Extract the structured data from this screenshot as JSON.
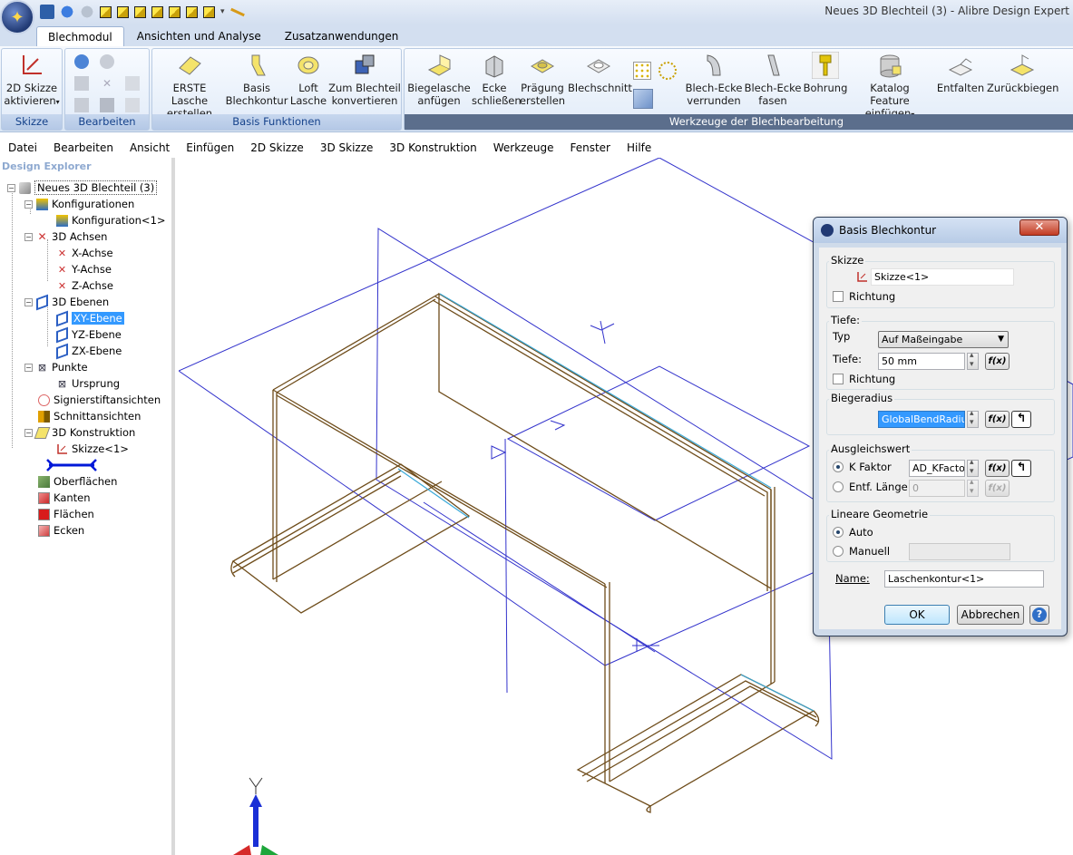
{
  "window": {
    "title": "Neues 3D Blechteil (3) - Alibre Design Expert"
  },
  "ribbon_tabs": [
    "Blechmodul",
    "Ansichten und Analyse",
    "Zusatzanwendungen"
  ],
  "ribbon": {
    "groups": {
      "skizze": "Skizze",
      "bearbeiten": "Bearbeiten",
      "basis": "Basis Funktionen",
      "werkzeuge": "Werkzeuge der Blechbearbeitung"
    },
    "buttons": {
      "skizze_line1": "2D Skizze",
      "skizze_line2": "aktivieren",
      "lasche_line1": "ERSTE Lasche",
      "lasche_line2": "erstellen",
      "basis_line1": "Basis",
      "basis_line2": "Blechkontur",
      "loft_line1": "Loft",
      "loft_line2": "Lasche",
      "zum_line1": "Zum Blechteil",
      "zum_line2": "konvertieren",
      "biegelasche_line1": "Biegelasche",
      "biegelasche_line2": "anfügen",
      "ecke_line1": "Ecke",
      "ecke_line2": "schließen",
      "praegung_line1": "Prägung",
      "praegung_line2": "erstellen",
      "blechschnitt": "Blechschnitt",
      "verrunden_line1": "Blech-Ecke",
      "verrunden_line2": "verrunden",
      "fasen_line1": "Blech-Ecke",
      "fasen_line2": "fasen",
      "bohrung": "Bohrung",
      "katalog_line1": "Katalog Feature",
      "katalog_line2": "einfügen",
      "entfalten": "Entfalten",
      "zurueckbiegen": "Zurückbiegen"
    }
  },
  "menu": [
    "Datei",
    "Bearbeiten",
    "Ansicht",
    "Einfügen",
    "2D Skizze",
    "3D Skizze",
    "3D Konstruktion",
    "Werkzeuge",
    "Fenster",
    "Hilfe"
  ],
  "explorer": {
    "title": "Design Explorer",
    "items": {
      "root": "Neues 3D Blechteil (3)",
      "konfigurationen": "Konfigurationen",
      "konfiguration1": "Konfiguration<1>",
      "achsen": "3D Achsen",
      "x_achse": "X-Achse",
      "y_achse": "Y-Achse",
      "z_achse": "Z-Achse",
      "ebenen": "3D Ebenen",
      "xy": "XY-Ebene",
      "yz": "YZ-Ebene",
      "zx": "ZX-Ebene",
      "punkte": "Punkte",
      "ursprung": "Ursprung",
      "signier": "Signierstiftansichten",
      "schnitt": "Schnittansichten",
      "konstruktion": "3D Konstruktion",
      "skizze1": "Skizze<1>",
      "oberflaechen": "Oberflächen",
      "kanten": "Kanten",
      "flaechen": "Flächen",
      "ecken": "Ecken"
    }
  },
  "dialog": {
    "title": "Basis Blechkontur",
    "skizze": {
      "group": "Skizze",
      "value": "Skizze<1>",
      "richtung": "Richtung"
    },
    "tiefe": {
      "group": "Tiefe:",
      "typ_label": "Typ",
      "typ_value": "Auf Maßeingabe",
      "tiefe_label": "Tiefe:",
      "tiefe_value": "50 mm",
      "richtung": "Richtung"
    },
    "biegeradius": {
      "group": "Biegeradius",
      "value": "GlobalBendRadius"
    },
    "ausgleich": {
      "group": "Ausgleichswert",
      "kfaktor_label": "K Faktor",
      "kfaktor_value": "AD_KFactor",
      "laenge_label": "Entf. Länge",
      "laenge_value": "0"
    },
    "linear": {
      "group": "Lineare Geometrie",
      "auto": "Auto",
      "manuell": "Manuell"
    },
    "name_label": "Name:",
    "name_value": "Laschenkontur<1>",
    "fx": "f(x)",
    "ok": "OK",
    "cancel": "Abbrechen"
  }
}
